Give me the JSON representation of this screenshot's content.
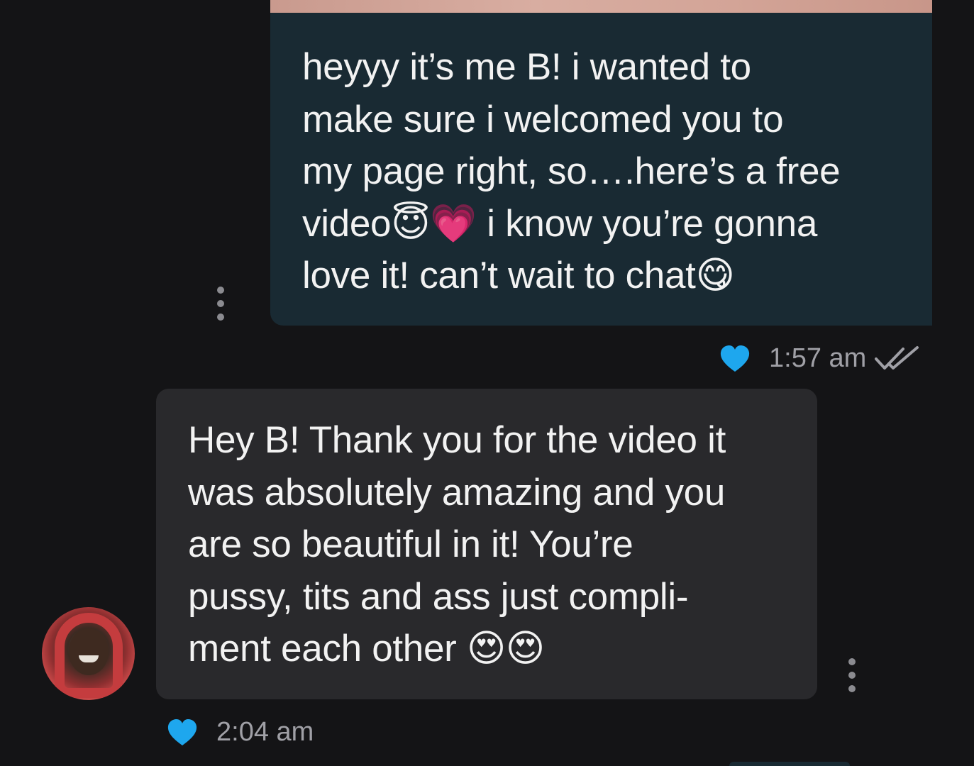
{
  "messages": [
    {
      "direction": "outgoing",
      "lines": [
        "heyyy it’s me B! i wanted to",
        "make sure i welcomed you to",
        "my page right, so….here’s a free",
        "video",
        "love it! can’t wait to chat"
      ],
      "line4_emojis": [
        "😇",
        "💗"
      ],
      "line4_after": " i know you’re gonna",
      "line5_emoji": "😋",
      "time": "1:57 am",
      "liked": true,
      "read_receipt": "double-check"
    },
    {
      "direction": "incoming",
      "lines": [
        "Hey B! Thank you for the video it",
        "was absolutely amazing and you",
        "are so beautiful in it! You’re",
        "pussy, tits and ass just compli-",
        "ment each other "
      ],
      "line5_emojis": [
        "😍",
        "😍"
      ],
      "time": "2:04 am",
      "liked": true
    }
  ],
  "colors": {
    "background": "#141416",
    "outgoing_bubble": "#192a33",
    "incoming_bubble": "#29292c",
    "heart": "#1ea7ee",
    "meta_text": "#a0a0a6"
  },
  "icons": {
    "like": "heart-icon",
    "more": "more-vertical-icon",
    "read": "double-check-icon"
  }
}
